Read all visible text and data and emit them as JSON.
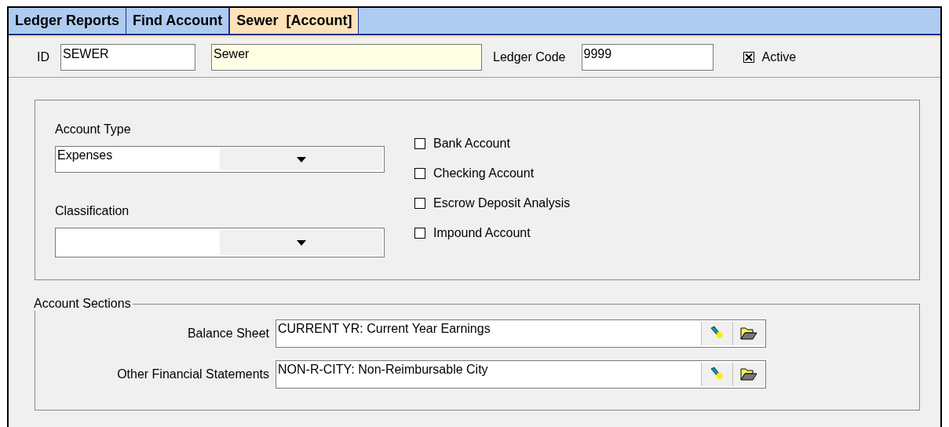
{
  "tabs": [
    {
      "label": "Ledger Reports",
      "selected": false
    },
    {
      "label": "Find Account",
      "selected": false
    },
    {
      "label": "Sewer  [Account]",
      "selected": true
    }
  ],
  "header": {
    "id_label": "ID",
    "id_value": "SEWER",
    "name_value": "Sewer",
    "ledger_code_label": "Ledger Code",
    "ledger_code_value": "9999",
    "active": {
      "label": "Active",
      "checked": true
    }
  },
  "account_type": {
    "label": "Account Type",
    "value": "Expenses"
  },
  "classification": {
    "label": "Classification"
  },
  "flags": [
    {
      "label": "Bank Account",
      "checked": false
    },
    {
      "label": "Checking Account",
      "checked": false
    },
    {
      "label": "Escrow Deposit Analysis",
      "checked": false
    },
    {
      "label": "Impound Account",
      "checked": false
    }
  ],
  "account_sections": {
    "title": "Account Sections",
    "rows": [
      {
        "label": "Balance Sheet",
        "value": "CURRENT YR: Current Year Earnings"
      },
      {
        "label": "Other Financial Statements",
        "value": "NON-R-CITY: Non-Reimbursable City"
      }
    ]
  }
}
